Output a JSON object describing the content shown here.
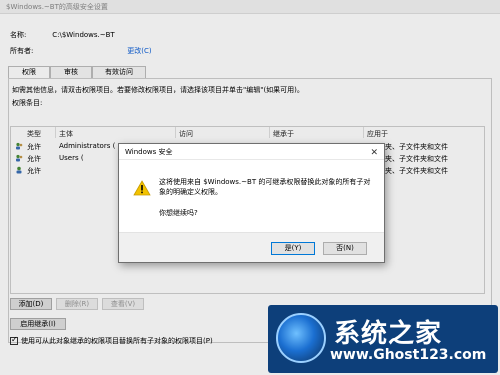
{
  "window": {
    "title": "$Windows.~BT的高级安全设置"
  },
  "info": {
    "name_label": "名称:",
    "name_value": "C:\\$Windows.~BT",
    "owner_label": "所有者:",
    "change_link": "更改(C)"
  },
  "tabs": [
    {
      "label": "权限"
    },
    {
      "label": "审核"
    },
    {
      "label": "有效访问"
    }
  ],
  "description": "如需其他信息，请双击权限项目。若要修改权限项目，请选择该项目并单击\"编辑\"(如果可用)。",
  "entries_label": "权限条目:",
  "table": {
    "columns": [
      "类型",
      "主体",
      "访问",
      "继承于",
      "应用于"
    ],
    "rows": [
      {
        "type": "允许",
        "principal": "Administrators (",
        "applies_to": "夹、子文件夹和文件"
      },
      {
        "type": "允许",
        "principal": "Users (",
        "applies_to": "夹、子文件夹和文件"
      },
      {
        "type": "允许",
        "principal": "",
        "applies_to": "夹、子文件夹和文件"
      }
    ]
  },
  "buttons": {
    "add": "添加(D)",
    "remove": "删除(R)",
    "view": "查看(V)",
    "enable_inheritance": "启用继承(I)"
  },
  "checkbox": {
    "label": "使用可从此对象继承的权限项目替换所有子对象的权限项目(P)",
    "checked": true
  },
  "dialog": {
    "title": "Windows 安全",
    "message": "这将使用来自 $Windows.~BT 的可继承权限替换此对象的所有子对象的明确定义权限。",
    "question": "你想继续吗?",
    "yes": "是(Y)",
    "no": "否(N)"
  },
  "watermark": {
    "title": "系统之家",
    "url": "www.Ghost123.com"
  },
  "colors": {
    "link": "#0b5ed7",
    "watermark_bg": "#0d3f7a",
    "warning": "#f2c200"
  }
}
